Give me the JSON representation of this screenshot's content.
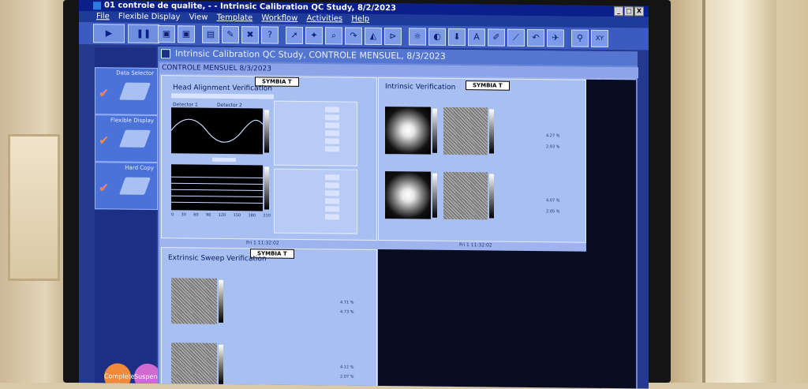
{
  "window": {
    "title": "01 controle de qualite, - - Intrinsic Calibration QC Study, 8/2/2023",
    "controls": [
      "_",
      "□",
      "X"
    ]
  },
  "menu": {
    "items": [
      "File",
      "Flexible Display",
      "View",
      "Template",
      "Workflow",
      "Activities",
      "Help"
    ]
  },
  "toolbar": {
    "play_icon": "▶",
    "pause_icon": "❚❚",
    "tool_icons": [
      "▣",
      "▣",
      "▤",
      "✎",
      "✖",
      "?",
      "➚",
      "✦",
      "⌕",
      "↷",
      "◭",
      "⊳",
      "☼",
      "◐",
      "⬇",
      "A",
      "✐",
      "⟋",
      "↶",
      "✈",
      "⚲",
      "XY"
    ]
  },
  "sidebar": {
    "items": [
      {
        "label": "Data Selector"
      },
      {
        "label": "Flexible Display"
      },
      {
        "label": "Hard Copy"
      }
    ],
    "check": "✔",
    "complete": "Complete",
    "suspend": "Suspend"
  },
  "study": {
    "title": "Intrinsic Calibration QC Study, CONTROLE MENSUEL, 8/3/2023",
    "tab": "CONTROLE MENSUEL 8/3/2023"
  },
  "head_alignment": {
    "title": "Head Alignment Verification",
    "badge": "SYMBIA T",
    "det1": "Detector 1",
    "det2": "Detector 2",
    "x_ticks": [
      "0",
      "30",
      "60",
      "90",
      "120",
      "150",
      "180",
      "210"
    ],
    "footer": "Fri 1 11:32:02"
  },
  "intrinsic": {
    "title": "Intrinsic Verification",
    "badge": "SYMBIA T",
    "footer": "Fri 1 11:32:02",
    "stats1": [
      "4.27 %",
      "2.03 %"
    ],
    "stats2": [
      "4.07 %",
      "2.05 %"
    ]
  },
  "extrinsic": {
    "title": "Extrinsic Sweep Verification",
    "badge": "SYMBIA T",
    "stats1": [
      "4.71 %",
      "4.73 %"
    ],
    "stats2": [
      "4.12 %",
      "2.07 %"
    ]
  },
  "colors": {
    "screen": "#243a8e",
    "titlebar": "#0b1f8a",
    "panel": "#a8bff2",
    "complete": "#f08a3a",
    "suspend": "#d06ad0"
  }
}
